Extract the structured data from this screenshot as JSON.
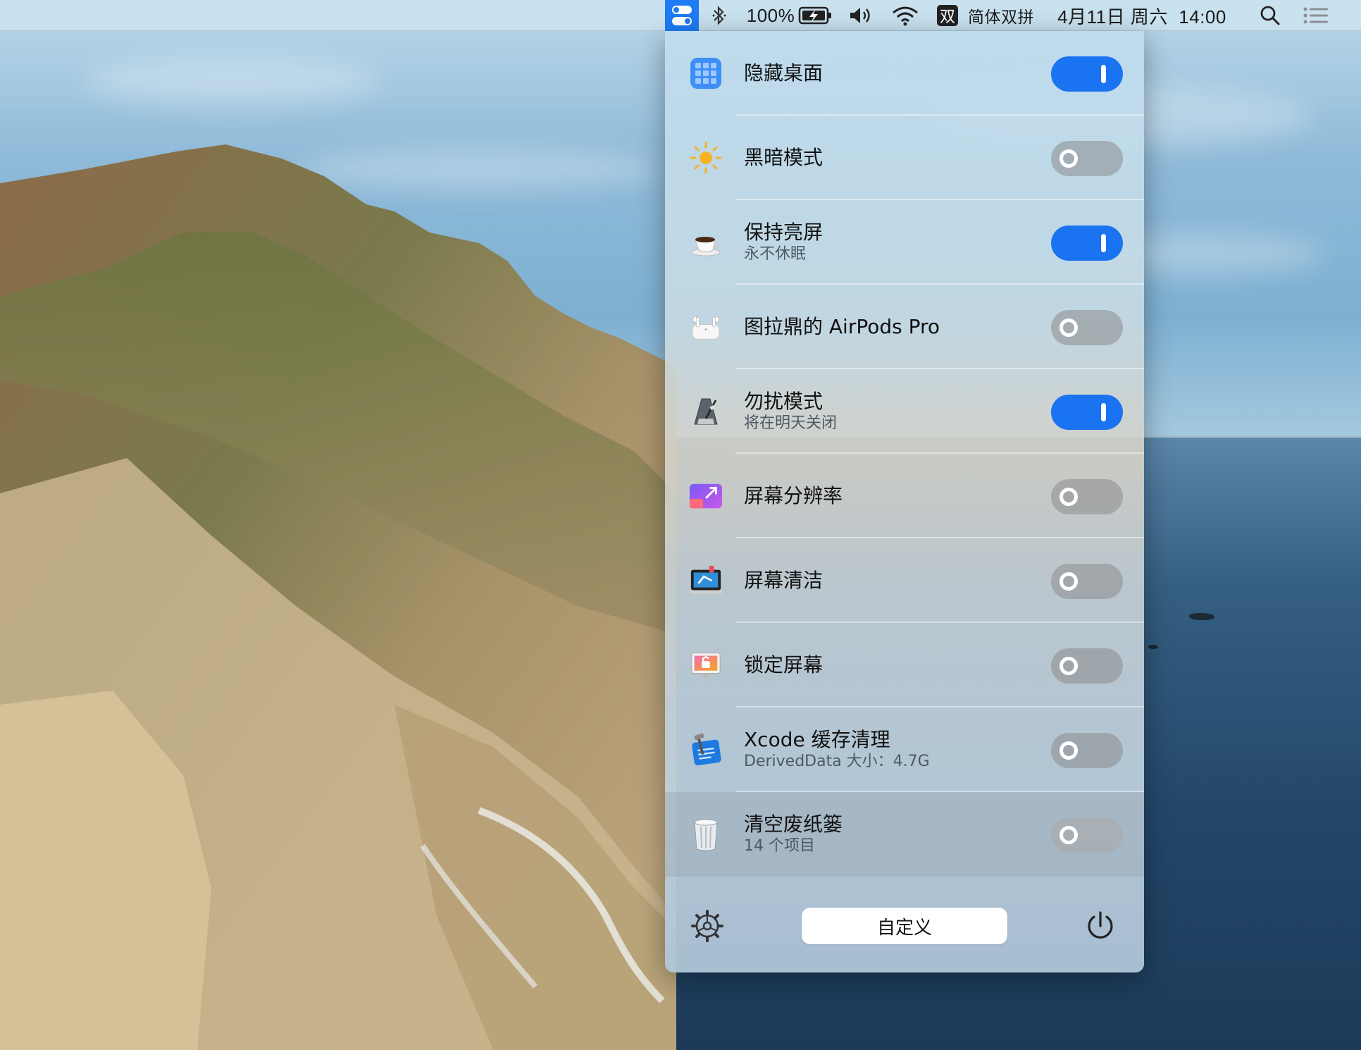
{
  "menubar": {
    "battery_percent": "100%",
    "ime_badge": "双",
    "ime_name": "简体双拼",
    "datetime": "4月11日 周六  14:00",
    "icons": [
      "app-status-icon",
      "bluetooth-icon",
      "battery-charging-icon",
      "volume-icon",
      "wifi-icon",
      "ime-icon",
      "spotlight-search-icon",
      "notification-center-icon"
    ]
  },
  "panel": {
    "rows": [
      {
        "title": "隐藏桌面",
        "subtitle": "",
        "icon": "grid-app-icon",
        "toggle": "on"
      },
      {
        "title": "黑暗模式",
        "subtitle": "",
        "icon": "sun-icon",
        "toggle": "off"
      },
      {
        "title": "保持亮屏",
        "subtitle": "永不休眠",
        "icon": "coffee-cup-icon",
        "toggle": "on"
      },
      {
        "title": "图拉鼎的 AirPods Pro",
        "subtitle": "",
        "icon": "airpods-icon",
        "toggle": "off"
      },
      {
        "title": "勿扰模式",
        "subtitle": "将在明天关闭",
        "icon": "metronome-icon",
        "toggle": "on"
      },
      {
        "title": "屏幕分辨率",
        "subtitle": "",
        "icon": "resolution-icon",
        "toggle": "off"
      },
      {
        "title": "屏幕清洁",
        "subtitle": "",
        "icon": "screen-clean-icon",
        "toggle": "off"
      },
      {
        "title": "锁定屏幕",
        "subtitle": "",
        "icon": "lock-screen-icon",
        "toggle": "off"
      },
      {
        "title": "Xcode 缓存清理",
        "subtitle": "DerivedData 大小：4.7G",
        "icon": "xcode-icon",
        "toggle": "off"
      },
      {
        "title": "清空废纸篓",
        "subtitle": "14 个项目",
        "icon": "trash-icon",
        "toggle": "off"
      }
    ],
    "customize_label": "自定义"
  },
  "colors": {
    "toggle_on": "#1a73f0",
    "toggle_off": "#8c8c8c",
    "accent": "#1e7cf5"
  }
}
